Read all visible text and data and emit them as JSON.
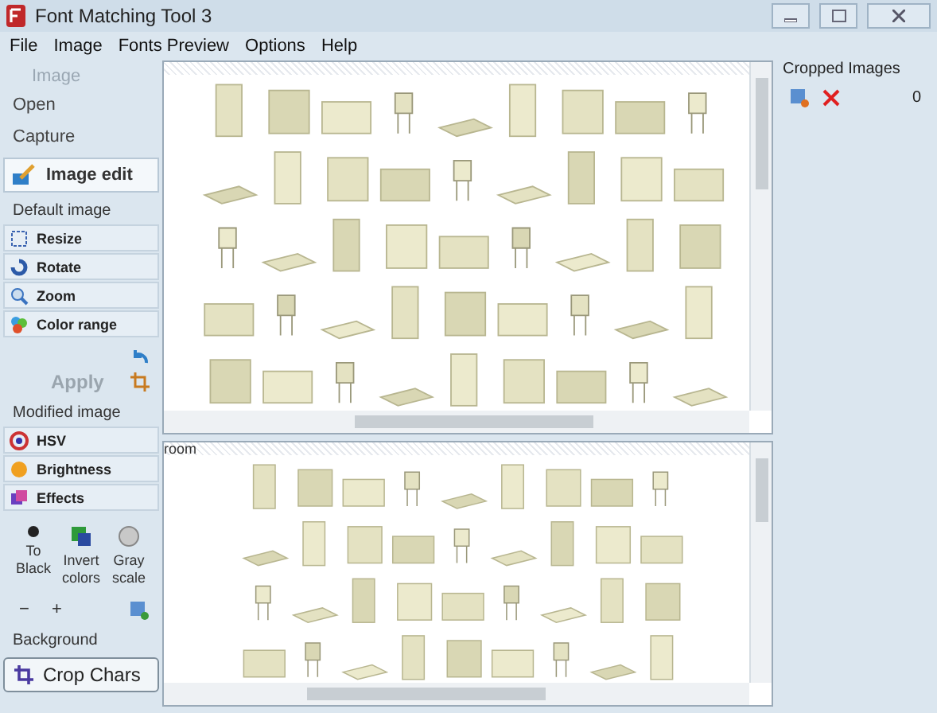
{
  "window": {
    "title": "Font Matching Tool 3"
  },
  "menu": [
    "File",
    "Image",
    "Fonts Preview",
    "Options",
    "Help"
  ],
  "sidebar": {
    "header": "Image",
    "actions": [
      "Open",
      "Capture"
    ],
    "image_edit": {
      "label": "Image edit",
      "selected": true
    },
    "default_section": "Default image",
    "default_tools": [
      "Resize",
      "Rotate",
      "Zoom",
      "Color range"
    ],
    "apply": {
      "label": "Apply",
      "disabled": true
    },
    "modified_section": "Modified image",
    "modified_tools": [
      "HSV",
      "Brightness",
      "Effects"
    ],
    "conversions": [
      "To Black",
      "Invert colors",
      "Gray scale"
    ],
    "steppers": [
      "−",
      "+"
    ],
    "background_label": "Background",
    "crop_button": "Crop Chars"
  },
  "preview": {
    "lower_caption": "room"
  },
  "cropped": {
    "title": "Cropped Images",
    "count": "0"
  }
}
